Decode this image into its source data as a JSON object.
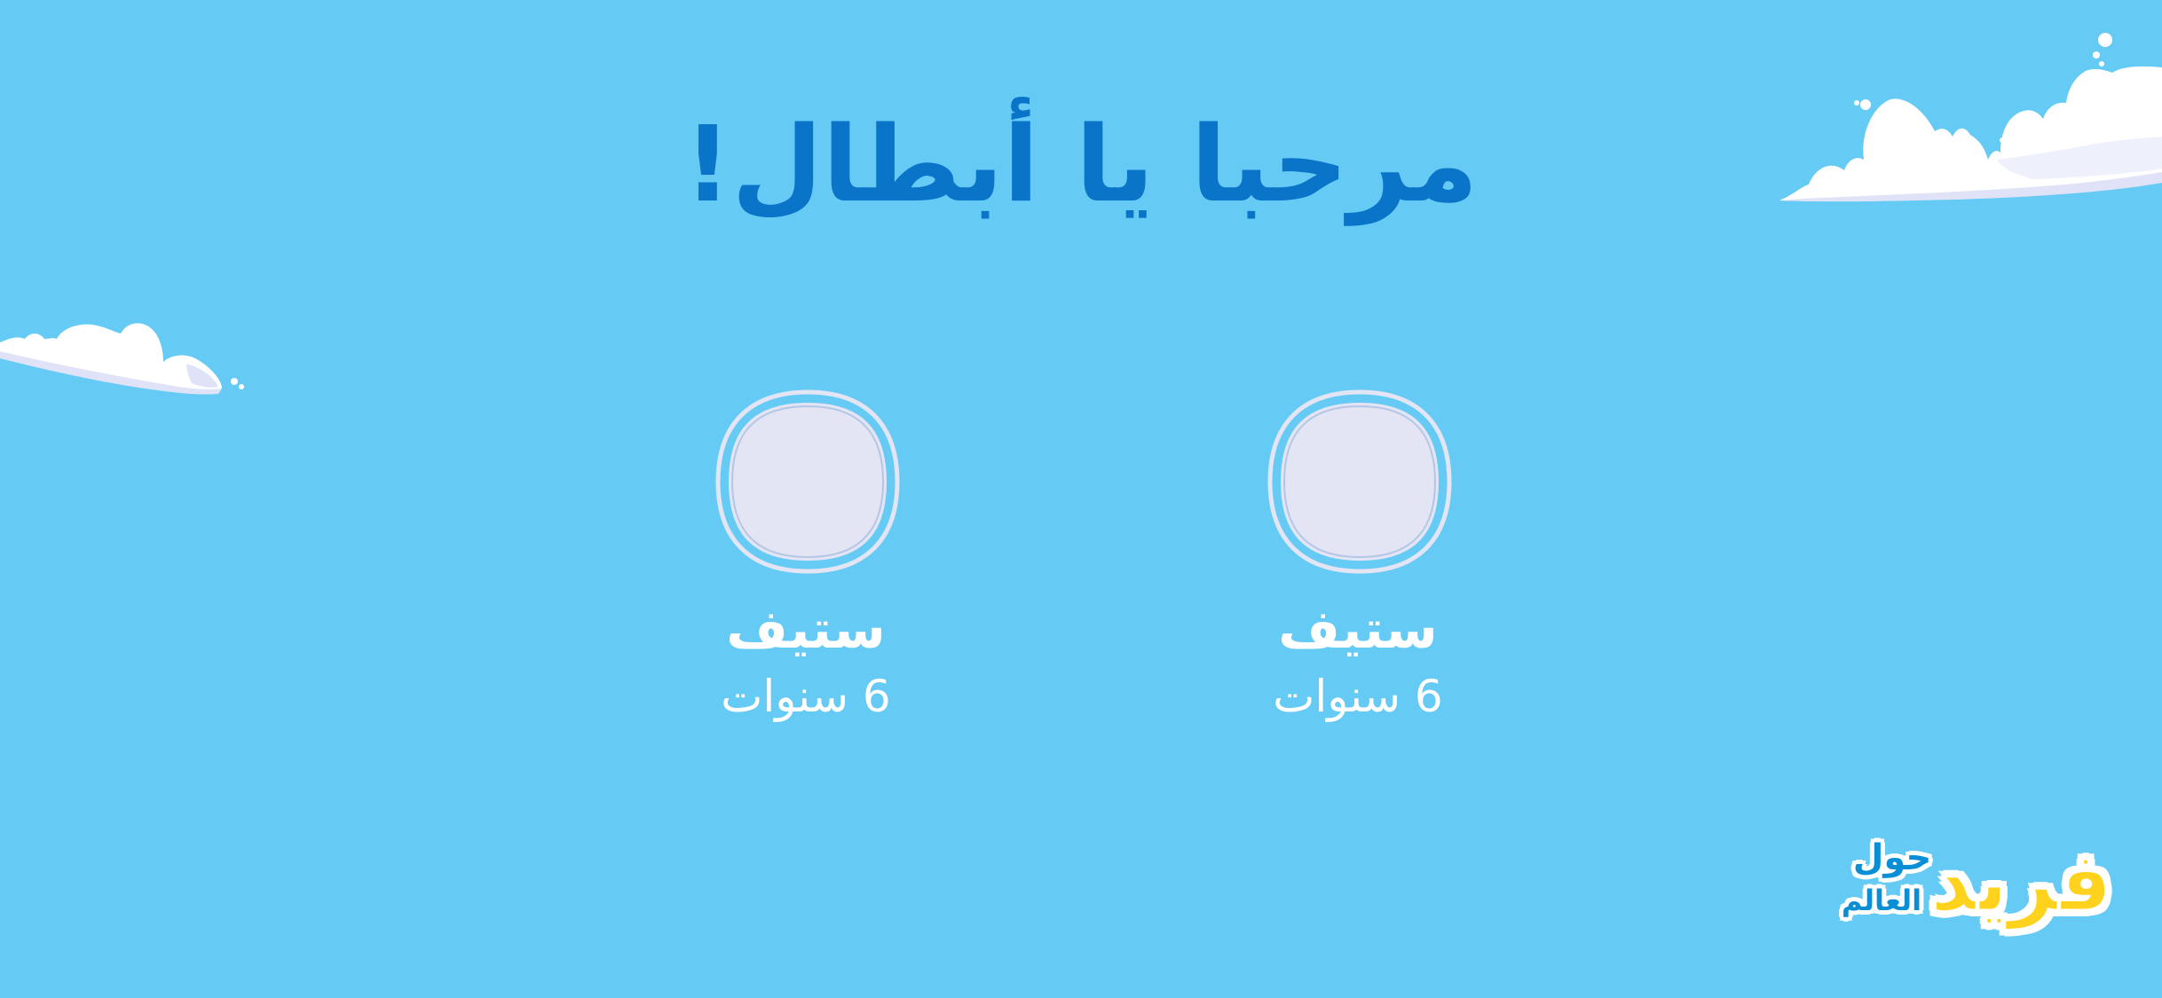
{
  "screen": {
    "background_color": "#66cbf4",
    "title": "مرحبا يا أبطال!",
    "title_color": "#0a74c9"
  },
  "profiles": [
    {
      "name": "ستيف",
      "age_label": "6 سنوات",
      "avatar_icon": "avatar-placeholder-icon"
    },
    {
      "name": "ستيف",
      "age_label": "6 سنوات",
      "avatar_icon": "avatar-placeholder-icon"
    }
  ],
  "brand": {
    "logo_main": "فريد",
    "logo_line1": "حول",
    "logo_line2": "العالم",
    "logo_main_color": "#ffd21e",
    "logo_secondary_color": "#0a8fd6"
  },
  "decorations": {
    "cloud_color": "#ffffff",
    "cloud_shade_color": "#e0e3f8"
  }
}
